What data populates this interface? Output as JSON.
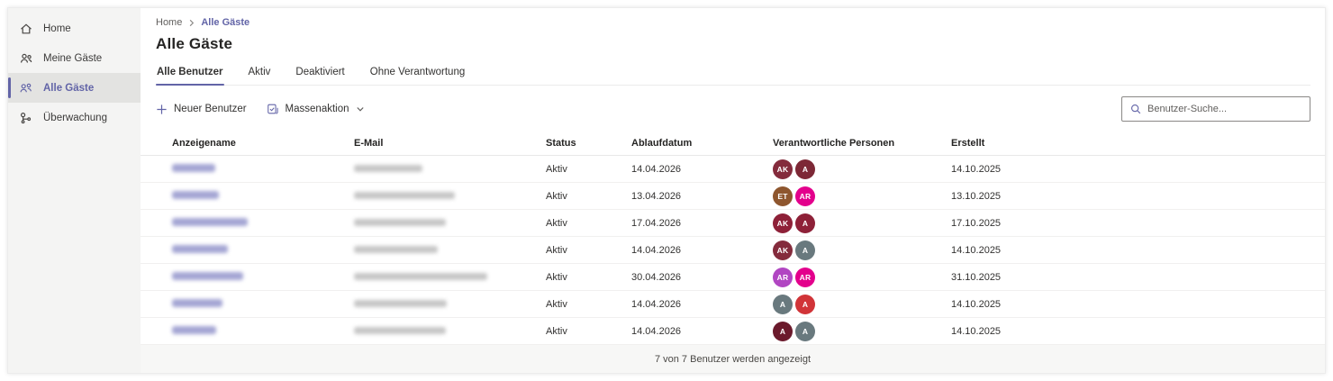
{
  "app": {
    "accent_color": "#6264a7"
  },
  "sidebar": {
    "items": [
      {
        "label": "Home",
        "icon": "home-icon",
        "selected": false
      },
      {
        "label": "Meine Gäste",
        "icon": "my-guests-icon",
        "selected": false
      },
      {
        "label": "Alle Gäste",
        "icon": "all-guests-icon",
        "selected": true
      },
      {
        "label": "Überwachung",
        "icon": "monitoring-icon",
        "selected": false
      }
    ]
  },
  "breadcrumb": {
    "items": [
      "Home",
      "Alle Gäste"
    ]
  },
  "page": {
    "title": "Alle Gäste"
  },
  "tabs": [
    {
      "label": "Alle Benutzer",
      "selected": true
    },
    {
      "label": "Aktiv",
      "selected": false
    },
    {
      "label": "Deaktiviert",
      "selected": false
    },
    {
      "label": "Ohne Verantwortung",
      "selected": false
    }
  ],
  "toolbar": {
    "new_user_label": "Neuer Benutzer",
    "bulk_action_label": "Massenaktion",
    "search_placeholder": "Benutzer-Suche..."
  },
  "table": {
    "columns": [
      "Anzeigename",
      "E-Mail",
      "Status",
      "Ablaufdatum",
      "Verantwortliche Personen",
      "Erstellt"
    ],
    "rows": [
      {
        "name_redacted": true,
        "name_blur_width": 48,
        "email_blur_width": 76,
        "status": "Aktiv",
        "expiry": "14.04.2026",
        "created": "14.10.2025",
        "owners": [
          {
            "initials": "AK",
            "color": "#842B3C"
          },
          {
            "initials": "A",
            "color": "#7D2836"
          }
        ]
      },
      {
        "name_redacted": true,
        "name_blur_width": 52,
        "email_blur_width": 112,
        "status": "Aktiv",
        "expiry": "13.04.2026",
        "created": "13.10.2025",
        "owners": [
          {
            "initials": "ET",
            "color": "#8E562E"
          },
          {
            "initials": "AR",
            "color": "#E3008C"
          }
        ]
      },
      {
        "name_redacted": true,
        "name_blur_width": 84,
        "email_blur_width": 102,
        "status": "Aktiv",
        "expiry": "17.04.2026",
        "created": "17.10.2025",
        "owners": [
          {
            "initials": "AK",
            "color": "#8E2138"
          },
          {
            "initials": "A",
            "color": "#8E2138"
          }
        ]
      },
      {
        "name_redacted": true,
        "name_blur_width": 62,
        "email_blur_width": 93,
        "status": "Aktiv",
        "expiry": "14.04.2026",
        "created": "14.10.2025",
        "owners": [
          {
            "initials": "AK",
            "color": "#842B3C"
          },
          {
            "initials": "A",
            "color": "#69797E"
          }
        ]
      },
      {
        "name_redacted": true,
        "name_blur_width": 79,
        "email_blur_width": 148,
        "status": "Aktiv",
        "expiry": "30.04.2026",
        "created": "31.10.2025",
        "owners": [
          {
            "initials": "AR",
            "color": "#B146C2"
          },
          {
            "initials": "AR",
            "color": "#E3008C"
          }
        ]
      },
      {
        "name_redacted": true,
        "name_blur_width": 56,
        "email_blur_width": 103,
        "status": "Aktiv",
        "expiry": "14.04.2026",
        "created": "14.10.2025",
        "owners": [
          {
            "initials": "A",
            "color": "#69797E"
          },
          {
            "initials": "A",
            "color": "#D13438"
          }
        ]
      },
      {
        "name_redacted": true,
        "name_blur_width": 49,
        "email_blur_width": 102,
        "status": "Aktiv",
        "expiry": "14.04.2026",
        "created": "14.10.2025",
        "owners": [
          {
            "initials": "A",
            "color": "#6B1A2C"
          },
          {
            "initials": "A",
            "color": "#69797E"
          }
        ]
      }
    ],
    "footer": "7 von 7 Benutzer werden angezeigt"
  }
}
